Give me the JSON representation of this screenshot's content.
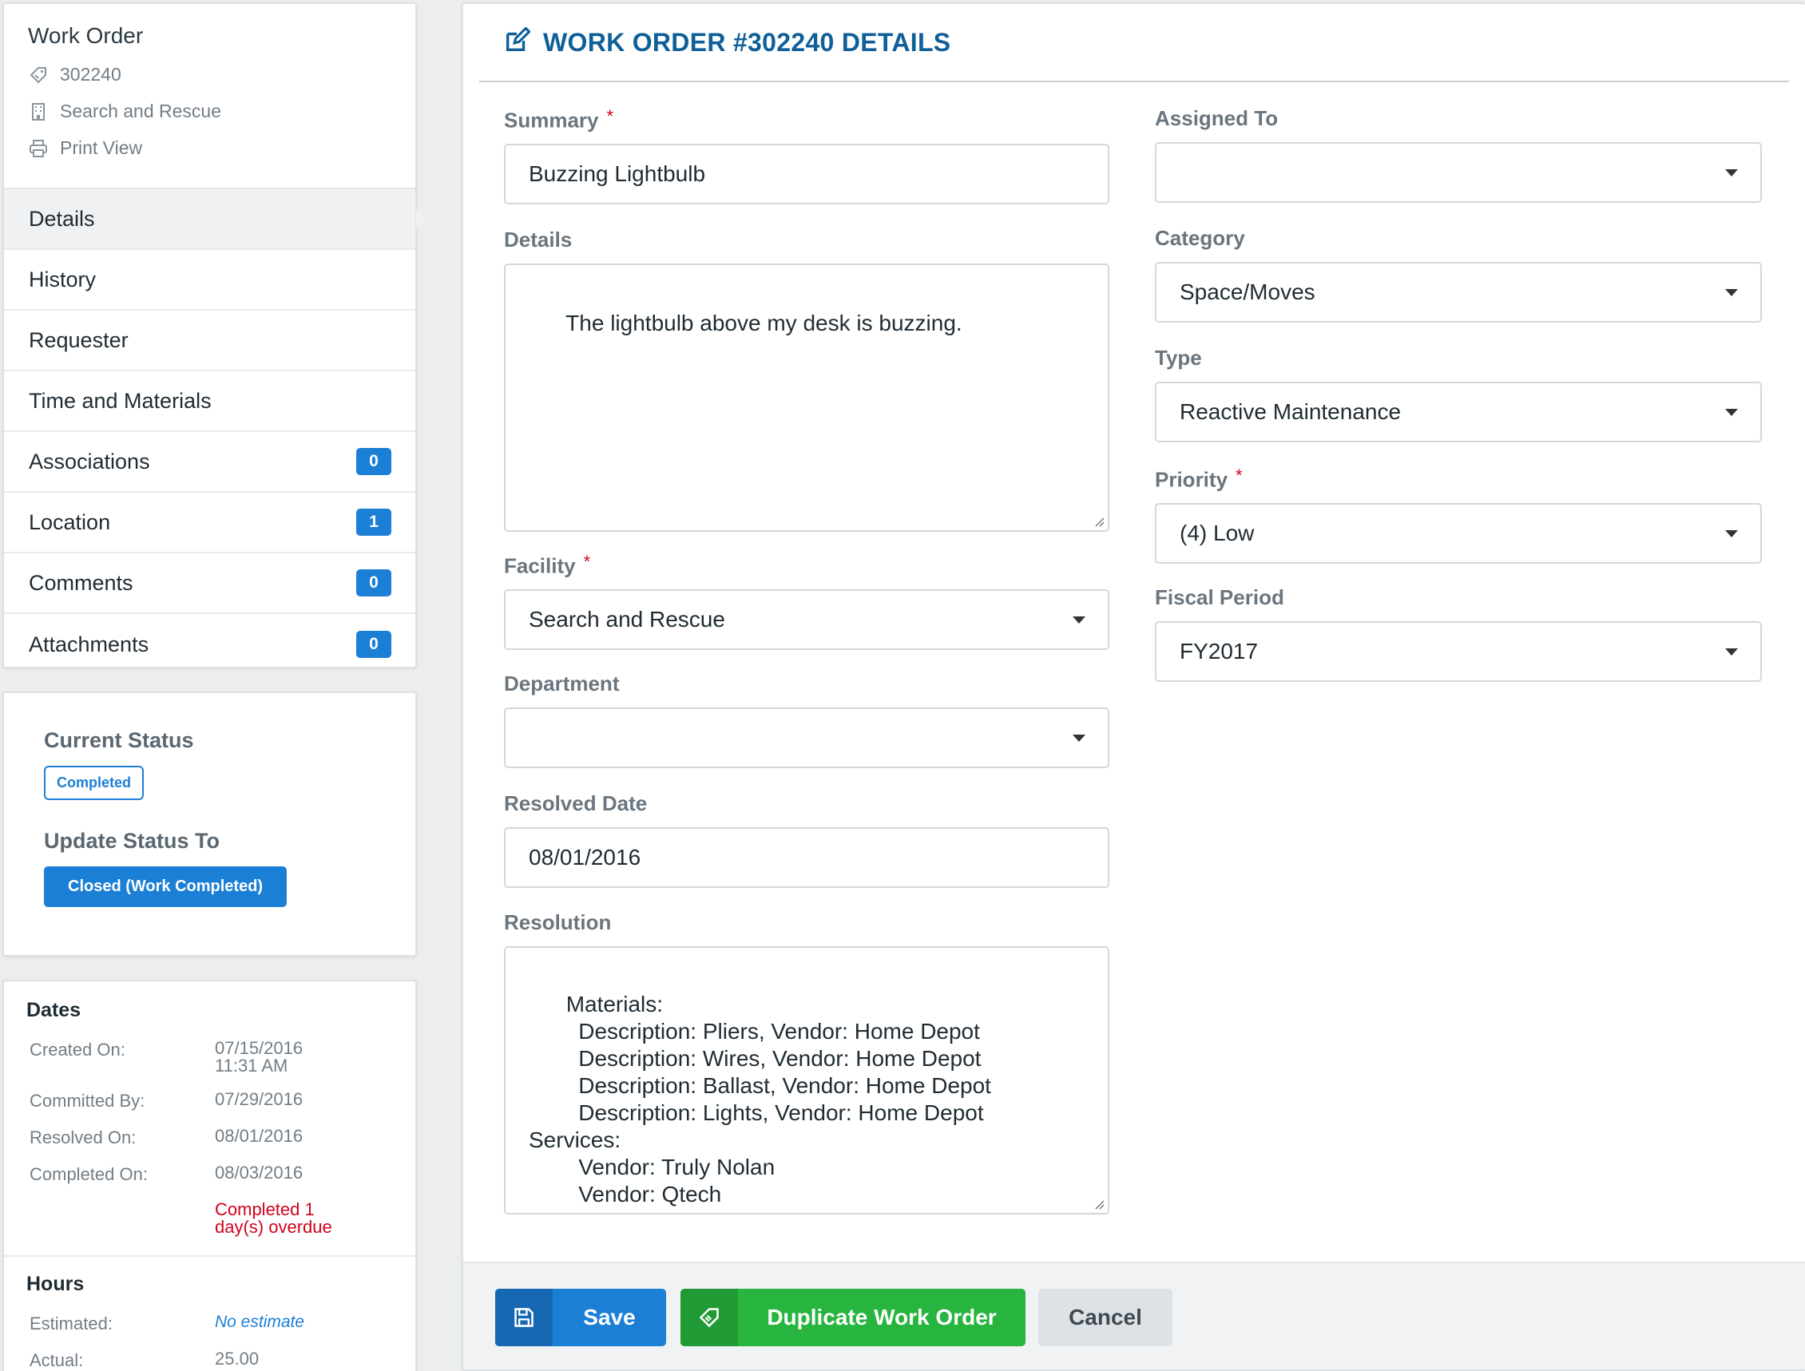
{
  "sidebar": {
    "title": "Work Order",
    "meta": [
      {
        "icon": "tag-icon",
        "text": "302240"
      },
      {
        "icon": "building-icon",
        "text": "Search and Rescue"
      },
      {
        "icon": "printer-icon",
        "text": "Print View"
      }
    ],
    "nav": [
      {
        "label": "Details",
        "active": true
      },
      {
        "label": "History"
      },
      {
        "label": "Requester"
      },
      {
        "label": "Time and Materials"
      },
      {
        "label": "Associations",
        "badge": "0"
      },
      {
        "label": "Location",
        "badge": "1"
      },
      {
        "label": "Comments",
        "badge": "0"
      },
      {
        "label": "Attachments",
        "badge": "0"
      }
    ]
  },
  "status": {
    "current_label": "Current Status",
    "current_value": "Completed",
    "update_label": "Update Status To",
    "update_button": "Closed (Work Completed)"
  },
  "dates": {
    "title": "Dates",
    "rows": [
      {
        "k": "Created On:",
        "v1": "07/15/2016",
        "v2": "11:31 AM"
      },
      {
        "k": "Committed By:",
        "v1": "07/29/2016"
      },
      {
        "k": "Resolved On:",
        "v1": "08/01/2016"
      },
      {
        "k": "Completed On:",
        "v1": "08/03/2016"
      }
    ],
    "overdue_1": "Completed 1",
    "overdue_2": "day(s) overdue"
  },
  "hours": {
    "title": "Hours",
    "estimated_label": "Estimated:",
    "estimated_value": "No estimate",
    "actual_label": "Actual:",
    "actual_value": "25.00"
  },
  "main": {
    "title": "WORK ORDER #302240 DETAILS",
    "summary": {
      "label": "Summary",
      "value": "Buzzing Lightbulb"
    },
    "details": {
      "label": "Details",
      "value": "The lightbulb above my desk is buzzing."
    },
    "facility": {
      "label": "Facility",
      "value": "Search and Rescue"
    },
    "department": {
      "label": "Department",
      "value": ""
    },
    "resolved_date": {
      "label": "Resolved Date",
      "value": "08/01/2016"
    },
    "resolution": {
      "label": "Resolution",
      "value": "Materials:\n        Description: Pliers, Vendor: Home Depot\n        Description: Wires, Vendor: Home Depot\n        Description: Ballast, Vendor: Home Depot\n        Description: Lights, Vendor: Home Depot\nServices:\n        Vendor: Truly Nolan\n        Vendor: Qtech"
    },
    "assigned_to": {
      "label": "Assigned To",
      "value": ""
    },
    "category": {
      "label": "Category",
      "value": "Space/Moves"
    },
    "type": {
      "label": "Type",
      "value": "Reactive Maintenance"
    },
    "priority": {
      "label": "Priority",
      "value": "(4) Low"
    },
    "fiscal_period": {
      "label": "Fiscal Period",
      "value": "FY2017"
    },
    "required_mark": "*"
  },
  "footer": {
    "save": "Save",
    "duplicate": "Duplicate Work Order",
    "cancel": "Cancel"
  },
  "colors": {
    "accent": "#1c7fd6",
    "title": "#0f5f99",
    "success": "#27b53f",
    "danger": "#d0021b"
  }
}
